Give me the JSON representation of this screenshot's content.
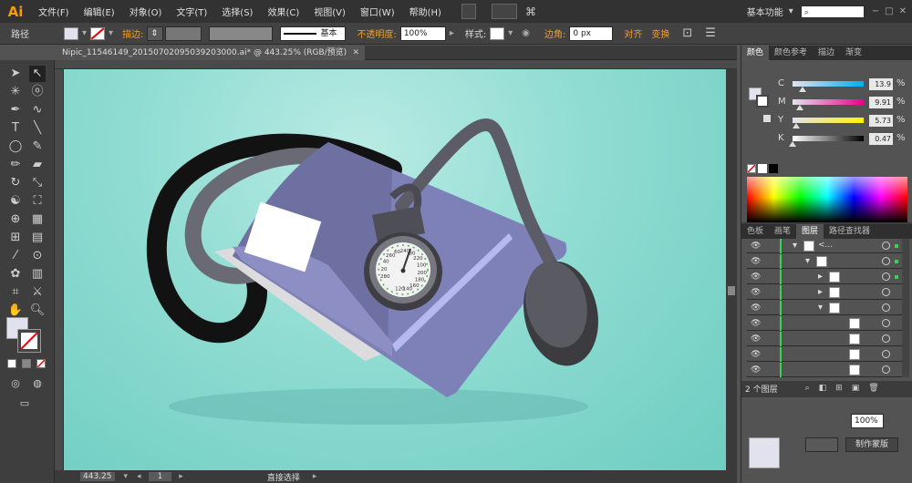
{
  "app": {
    "logo": "Ai"
  },
  "menus": [
    "文件(F)",
    "编辑(E)",
    "对象(O)",
    "文字(T)",
    "选择(S)",
    "效果(C)",
    "视图(V)",
    "窗口(W)",
    "帮助(H)"
  ],
  "workspace": "基本功能",
  "control": {
    "selection": "路径",
    "stroke_label": "描边:",
    "stroke_profile": "基本",
    "opacity_label": "不透明度:",
    "opacity_value": "100%",
    "style_label": "样式:",
    "corner_label": "边角:",
    "corner_value": "0 px",
    "align_label": "对齐",
    "transform_label": "变换"
  },
  "document": {
    "tab_title": "Nipic_11546149_20150702095039203000.ai* @ 443.25% (RGB/预览)"
  },
  "status": {
    "zoom": "443.25",
    "page": "1",
    "tool": "直接选择"
  },
  "color_panel": {
    "tabs": [
      "颜色",
      "颜色参考",
      "描边",
      "渐变"
    ],
    "channels": [
      {
        "label": "C",
        "value": "13.9",
        "pct": 0.139
      },
      {
        "label": "M",
        "value": "9.91",
        "pct": 0.099
      },
      {
        "label": "Y",
        "value": "5.73",
        "pct": 0.057
      },
      {
        "label": "K",
        "value": "0.47",
        "pct": 0.005
      }
    ]
  },
  "layers_panel": {
    "tabs": [
      "色板",
      "画笔",
      "图层",
      "路径查找器"
    ],
    "first_name": "<...",
    "count": "2 个图层"
  },
  "bottom_panel": {
    "opacity_value": "100%",
    "mask_button": "制作蒙版"
  },
  "gauge_ticks": [
    "280",
    "20",
    "40",
    "260",
    "60",
    "240",
    "80",
    "220",
    "100",
    "200",
    "180",
    "160",
    "140",
    "120"
  ],
  "colors": {
    "canvas_bg": "#8fdcd2",
    "cuff": "#7d80b5",
    "tube": "#5c5c66",
    "accent": "#ff9a00"
  }
}
